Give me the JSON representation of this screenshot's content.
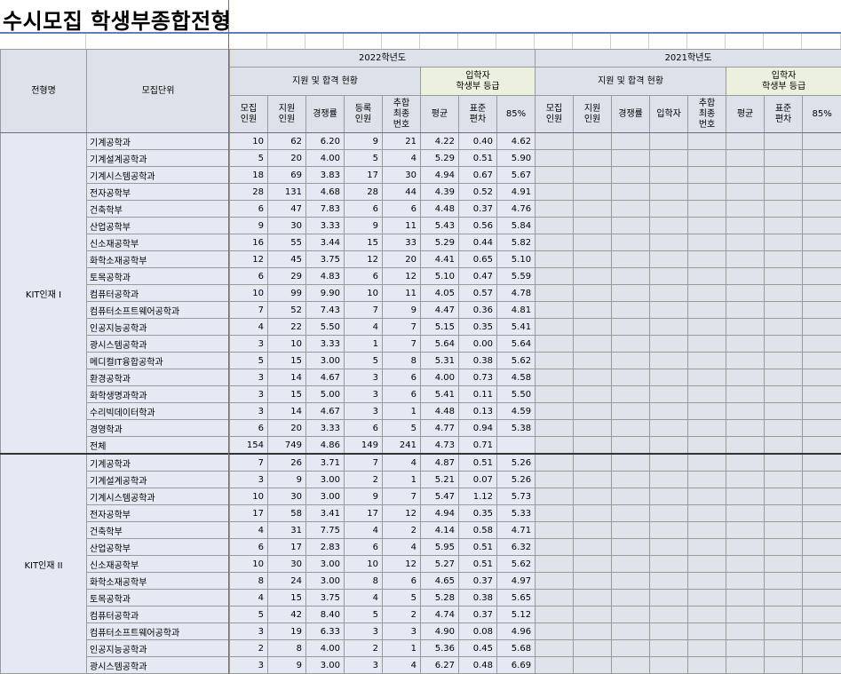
{
  "title": "수시모집 학생부종합전형",
  "headers": {
    "type_label": "전형명",
    "unit_label": "모집단위",
    "year_2022": "2022학년도",
    "year_2021": "2021학년도",
    "apply_status": "지원 및 합격 현황",
    "entrant_grade_l1": "입학자",
    "entrant_grade_l2": "학생부 등급",
    "col_recruit_l1": "모집",
    "col_recruit_l2": "인원",
    "col_apply_l1": "지원",
    "col_apply_l2": "인원",
    "col_ratio": "경쟁률",
    "col_reg_l1": "등록",
    "col_reg_l2": "인원",
    "col_final_l1": "추합",
    "col_final_l2": "최종",
    "col_final_l3": "번호",
    "col_entrant": "입학자",
    "col_avg": "평균",
    "col_std_l1": "표준",
    "col_std_l2": "편차",
    "col_85": "85%"
  },
  "groups": [
    {
      "name": "KIT인재 I",
      "rows": [
        [
          "기계공학과",
          "10",
          "62",
          "6.20",
          "9",
          "21",
          "4.22",
          "0.40",
          "4.62"
        ],
        [
          "기계설계공학과",
          "5",
          "20",
          "4.00",
          "5",
          "4",
          "5.29",
          "0.51",
          "5.90"
        ],
        [
          "기계시스템공학과",
          "18",
          "69",
          "3.83",
          "17",
          "30",
          "4.94",
          "0.67",
          "5.67"
        ],
        [
          "전자공학부",
          "28",
          "131",
          "4.68",
          "28",
          "44",
          "4.39",
          "0.52",
          "4.91"
        ],
        [
          "건축학부",
          "6",
          "47",
          "7.83",
          "6",
          "6",
          "4.48",
          "0.37",
          "4.76"
        ],
        [
          "산업공학부",
          "9",
          "30",
          "3.33",
          "9",
          "11",
          "5.43",
          "0.56",
          "5.84"
        ],
        [
          "신소재공학부",
          "16",
          "55",
          "3.44",
          "15",
          "33",
          "5.29",
          "0.44",
          "5.82"
        ],
        [
          "화학소재공학부",
          "12",
          "45",
          "3.75",
          "12",
          "20",
          "4.41",
          "0.65",
          "5.10"
        ],
        [
          "토목공학과",
          "6",
          "29",
          "4.83",
          "6",
          "12",
          "5.10",
          "0.47",
          "5.59"
        ],
        [
          "컴퓨터공학과",
          "10",
          "99",
          "9.90",
          "10",
          "11",
          "4.05",
          "0.57",
          "4.78"
        ],
        [
          "컴퓨터소프트웨어공학과",
          "7",
          "52",
          "7.43",
          "7",
          "9",
          "4.47",
          "0.36",
          "4.81"
        ],
        [
          "인공지능공학과",
          "4",
          "22",
          "5.50",
          "4",
          "7",
          "5.15",
          "0.35",
          "5.41"
        ],
        [
          "광시스템공학과",
          "3",
          "10",
          "3.33",
          "1",
          "7",
          "5.64",
          "0.00",
          "5.64"
        ],
        [
          "메디컬IT융합공학과",
          "5",
          "15",
          "3.00",
          "5",
          "8",
          "5.31",
          "0.38",
          "5.62"
        ],
        [
          "환경공학과",
          "3",
          "14",
          "4.67",
          "3",
          "6",
          "4.00",
          "0.73",
          "4.58"
        ],
        [
          "화학생명과학과",
          "3",
          "15",
          "5.00",
          "3",
          "6",
          "5.41",
          "0.11",
          "5.50"
        ],
        [
          "수리빅데이터학과",
          "3",
          "14",
          "4.67",
          "3",
          "1",
          "4.48",
          "0.13",
          "4.59"
        ],
        [
          "경영학과",
          "6",
          "20",
          "3.33",
          "6",
          "5",
          "4.77",
          "0.94",
          "5.38"
        ],
        [
          "전체",
          "154",
          "749",
          "4.86",
          "149",
          "241",
          "4.73",
          "0.71",
          ""
        ]
      ]
    },
    {
      "name": "KIT인재 II",
      "rows": [
        [
          "기계공학과",
          "7",
          "26",
          "3.71",
          "7",
          "4",
          "4.87",
          "0.51",
          "5.26"
        ],
        [
          "기계설계공학과",
          "3",
          "9",
          "3.00",
          "2",
          "1",
          "5.21",
          "0.07",
          "5.26"
        ],
        [
          "기계시스템공학과",
          "10",
          "30",
          "3.00",
          "9",
          "7",
          "5.47",
          "1.12",
          "5.73"
        ],
        [
          "전자공학부",
          "17",
          "58",
          "3.41",
          "17",
          "12",
          "4.94",
          "0.35",
          "5.33"
        ],
        [
          "건축학부",
          "4",
          "31",
          "7.75",
          "4",
          "2",
          "4.14",
          "0.58",
          "4.71"
        ],
        [
          "산업공학부",
          "6",
          "17",
          "2.83",
          "6",
          "4",
          "5.95",
          "0.51",
          "6.32"
        ],
        [
          "신소재공학부",
          "10",
          "30",
          "3.00",
          "10",
          "12",
          "5.27",
          "0.51",
          "5.62"
        ],
        [
          "화학소재공학부",
          "8",
          "24",
          "3.00",
          "8",
          "6",
          "4.65",
          "0.37",
          "4.97"
        ],
        [
          "토목공학과",
          "4",
          "15",
          "3.75",
          "4",
          "5",
          "5.28",
          "0.38",
          "5.65"
        ],
        [
          "컴퓨터공학과",
          "5",
          "42",
          "8.40",
          "5",
          "2",
          "4.74",
          "0.37",
          "5.12"
        ],
        [
          "컴퓨터소프트웨어공학과",
          "3",
          "19",
          "6.33",
          "3",
          "3",
          "4.90",
          "0.08",
          "4.96"
        ],
        [
          "인공지능공학과",
          "2",
          "8",
          "4.00",
          "2",
          "1",
          "5.36",
          "0.45",
          "5.68"
        ],
        [
          "광시스템공학과",
          "3",
          "9",
          "3.00",
          "3",
          "4",
          "6.27",
          "0.48",
          "6.69"
        ]
      ]
    }
  ]
}
